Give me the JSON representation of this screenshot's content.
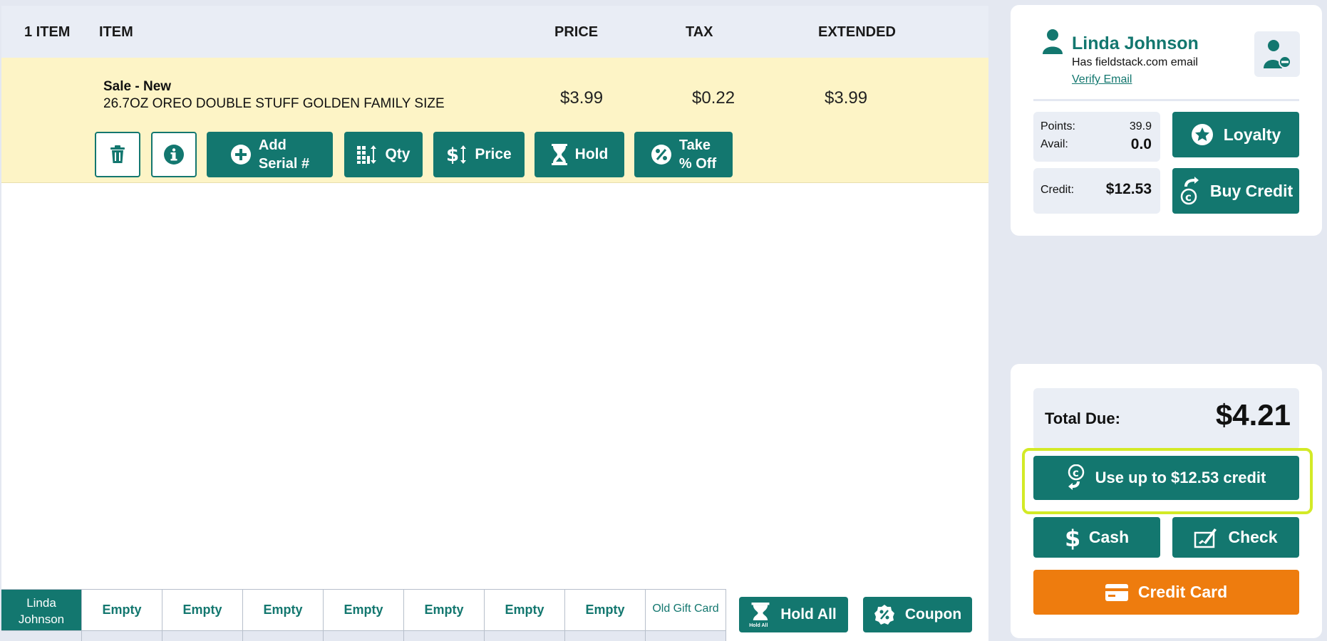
{
  "table": {
    "headers": {
      "count": "1 ITEM",
      "item": "ITEM",
      "price": "PRICE",
      "tax": "TAX",
      "extended": "EXTENDED"
    },
    "rows": [
      {
        "title": "Sale - New",
        "description": "26.7OZ OREO DOUBLE STUFF GOLDEN FAMILY SIZE",
        "price": "$3.99",
        "tax": "$0.22",
        "extended": "$3.99"
      }
    ]
  },
  "row_actions": {
    "add_serial": [
      "Add",
      "Serial #"
    ],
    "qty": "Qty",
    "price": "Price",
    "hold": "Hold",
    "take_off": [
      "Take",
      "% Off"
    ]
  },
  "tabs": [
    "Linda Johnson",
    "Empty",
    "Empty",
    "Empty",
    "Empty",
    "Empty",
    "Empty",
    "Empty",
    "Old Gift Card"
  ],
  "tab_active_lines": [
    "Linda",
    "Johnson"
  ],
  "tab_buttons": {
    "hold_all": "Hold All",
    "hold_all_icon_caption": "Hold All",
    "coupon": "Coupon"
  },
  "customer": {
    "name": "Linda Johnson",
    "email_status": "Has fieldstack.com email",
    "verify_link": "Verify Email",
    "points_label": "Points:",
    "points_value": "39.9",
    "avail_label": "Avail:",
    "avail_value": "0.0",
    "credit_label": "Credit:",
    "credit_value": "$12.53",
    "loyalty_button": "Loyalty",
    "buy_credit_button": "Buy Credit"
  },
  "payment": {
    "total_label": "Total Due:",
    "total_value": "$4.21",
    "use_credit_button": "Use up to $12.53 credit",
    "cash_button": "Cash",
    "check_button": "Check",
    "credit_card_button": "Credit Card"
  },
  "colors": {
    "teal": "#13776f",
    "orange": "#ee7c0e",
    "row_highlight": "#fdf4c6",
    "focus_ring": "#d3ea26",
    "background": "#e4e8f1"
  }
}
